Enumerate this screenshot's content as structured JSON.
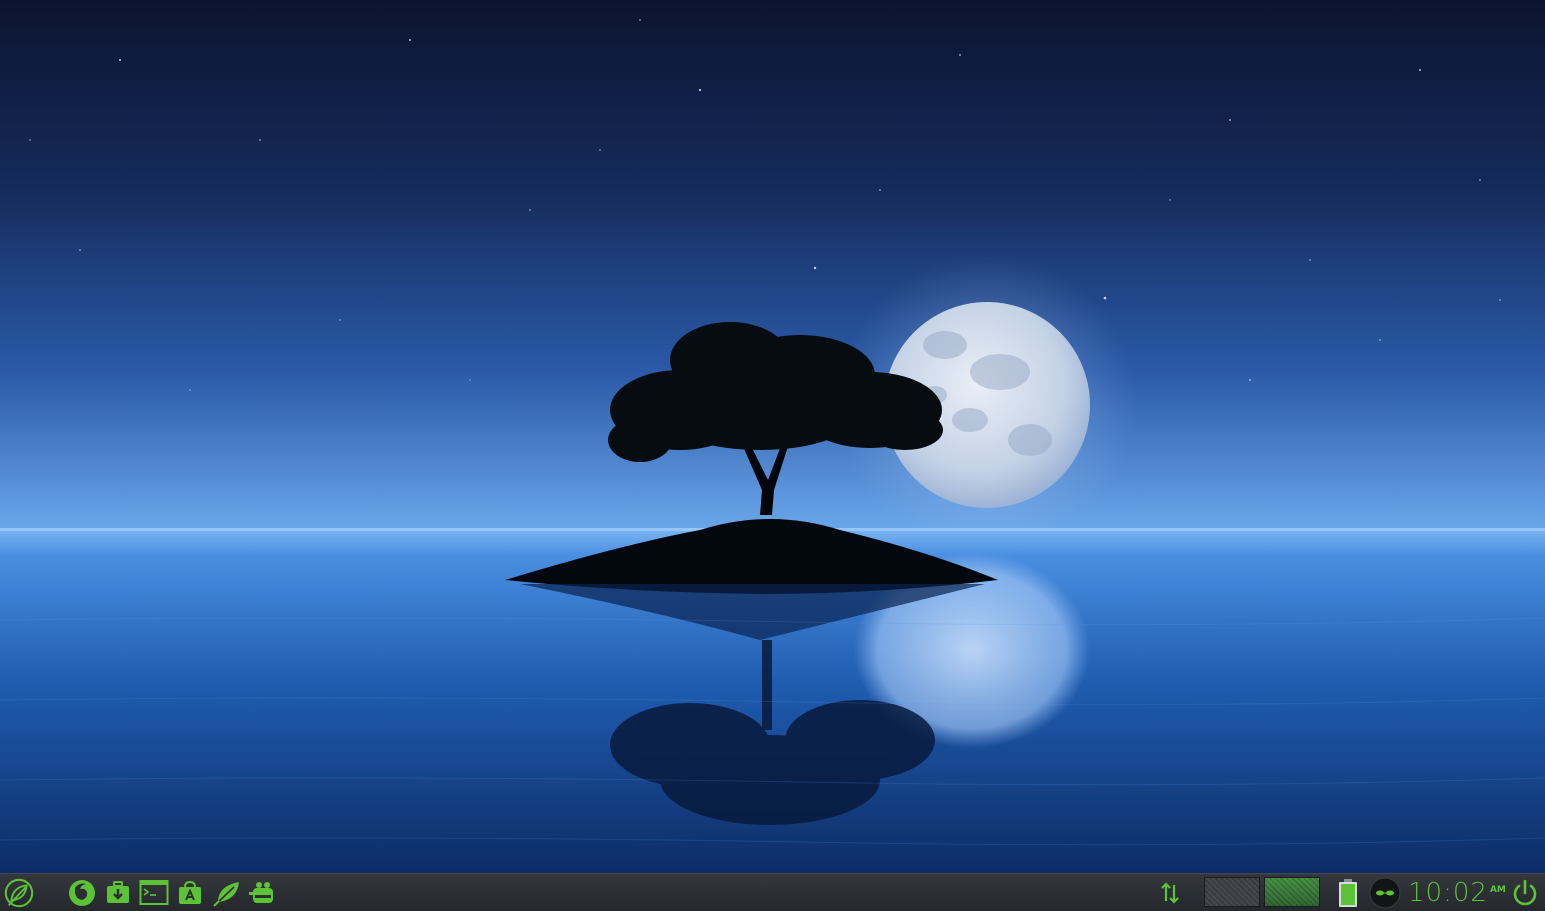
{
  "desktop": {
    "wallpaper": "night-sea-moon-tree-island"
  },
  "taskbar": {
    "accent_color": "#5cc236",
    "background_color": "#2b2e32",
    "menu_icon": "leaf-menu-icon",
    "launchers": [
      {
        "name": "firefox-launcher",
        "icon": "firefox-icon"
      },
      {
        "name": "software-installer-launcher",
        "icon": "package-download-icon"
      },
      {
        "name": "terminal-launcher",
        "icon": "terminal-icon"
      },
      {
        "name": "app-store-launcher",
        "icon": "store-bag-icon"
      },
      {
        "name": "leaf-app-launcher",
        "icon": "leaf-icon"
      },
      {
        "name": "gimp-launcher",
        "icon": "gimp-icon"
      }
    ],
    "tray": {
      "network_icon": "network-updown-icon",
      "workspaces": [
        {
          "name": "workspace-1",
          "active": false
        },
        {
          "name": "workspace-2",
          "active": true
        }
      ],
      "battery_icon": "battery-icon",
      "user_icon": "user-avatar-icon",
      "power_icon": "power-icon"
    },
    "clock": {
      "time": "10:02",
      "ampm": "AM"
    }
  }
}
